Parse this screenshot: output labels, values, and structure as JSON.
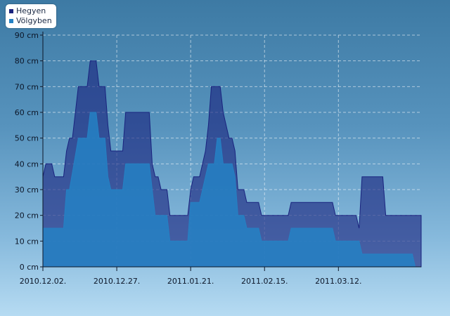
{
  "chart_data": {
    "type": "area",
    "title": "",
    "xlabel": "",
    "ylabel": "",
    "y_unit": "cm",
    "ylim": [
      0,
      90
    ],
    "xlim": [
      "2010-12-02",
      "2011-04-09"
    ],
    "grid": true,
    "legend_position": "top-left",
    "x_tick_labels": [
      "2010.12.02.",
      "2010.12.27.",
      "2011.01.21.",
      "2011.02.15.",
      "2011.03.12."
    ],
    "x_tick_dates": [
      "2010-12-02",
      "2010-12-27",
      "2011-01-21",
      "2011-02-15",
      "2011-03-12"
    ],
    "y_tick_labels": [
      "0 cm",
      "10 cm",
      "20 cm",
      "30 cm",
      "40 cm",
      "50 cm",
      "60 cm",
      "70 cm",
      "80 cm",
      "90 cm"
    ],
    "y_ticks": [
      0,
      10,
      20,
      30,
      40,
      50,
      60,
      70,
      80,
      90
    ],
    "series": [
      {
        "name": "Hegyen",
        "color": "#1a237e",
        "points": [
          [
            "2010-12-02",
            35
          ],
          [
            "2010-12-03",
            40
          ],
          [
            "2010-12-05",
            40
          ],
          [
            "2010-12-06",
            35
          ],
          [
            "2010-12-09",
            35
          ],
          [
            "2010-12-10",
            45
          ],
          [
            "2010-12-11",
            50
          ],
          [
            "2010-12-12",
            50
          ],
          [
            "2010-12-14",
            70
          ],
          [
            "2010-12-17",
            70
          ],
          [
            "2010-12-18",
            80
          ],
          [
            "2010-12-20",
            80
          ],
          [
            "2010-12-21",
            70
          ],
          [
            "2010-12-23",
            70
          ],
          [
            "2010-12-24",
            55
          ],
          [
            "2010-12-25",
            45
          ],
          [
            "2010-12-29",
            45
          ],
          [
            "2010-12-30",
            60
          ],
          [
            "2011-01-07",
            60
          ],
          [
            "2011-01-08",
            40
          ],
          [
            "2011-01-09",
            35
          ],
          [
            "2011-01-10",
            35
          ],
          [
            "2011-01-11",
            30
          ],
          [
            "2011-01-13",
            30
          ],
          [
            "2011-01-14",
            20
          ],
          [
            "2011-01-20",
            20
          ],
          [
            "2011-01-21",
            30
          ],
          [
            "2011-01-22",
            35
          ],
          [
            "2011-01-24",
            35
          ],
          [
            "2011-01-26",
            45
          ],
          [
            "2011-01-27",
            55
          ],
          [
            "2011-01-28",
            70
          ],
          [
            "2011-01-31",
            70
          ],
          [
            "2011-02-01",
            60
          ],
          [
            "2011-02-03",
            50
          ],
          [
            "2011-02-04",
            50
          ],
          [
            "2011-02-05",
            45
          ],
          [
            "2011-02-06",
            30
          ],
          [
            "2011-02-08",
            30
          ],
          [
            "2011-02-09",
            25
          ],
          [
            "2011-02-13",
            25
          ],
          [
            "2011-02-14",
            20
          ],
          [
            "2011-02-23",
            20
          ],
          [
            "2011-02-24",
            25
          ],
          [
            "2011-03-10",
            25
          ],
          [
            "2011-03-11",
            20
          ],
          [
            "2011-03-18",
            20
          ],
          [
            "2011-03-19",
            15
          ],
          [
            "2011-03-20",
            35
          ],
          [
            "2011-03-27",
            35
          ],
          [
            "2011-03-28",
            20
          ],
          [
            "2011-04-09",
            20
          ]
        ]
      },
      {
        "name": "Völgyben",
        "color": "#2581c4",
        "points": [
          [
            "2010-12-02",
            15
          ],
          [
            "2010-12-09",
            15
          ],
          [
            "2010-12-10",
            30
          ],
          [
            "2010-12-11",
            30
          ],
          [
            "2010-12-14",
            50
          ],
          [
            "2010-12-17",
            50
          ],
          [
            "2010-12-18",
            60
          ],
          [
            "2010-12-20",
            60
          ],
          [
            "2010-12-21",
            50
          ],
          [
            "2010-12-23",
            50
          ],
          [
            "2010-12-24",
            35
          ],
          [
            "2010-12-25",
            30
          ],
          [
            "2010-12-29",
            30
          ],
          [
            "2010-12-30",
            40
          ],
          [
            "2011-01-07",
            40
          ],
          [
            "2011-01-08",
            30
          ],
          [
            "2011-01-09",
            20
          ],
          [
            "2011-01-13",
            20
          ],
          [
            "2011-01-14",
            10
          ],
          [
            "2011-01-20",
            10
          ],
          [
            "2011-01-21",
            25
          ],
          [
            "2011-01-24",
            25
          ],
          [
            "2011-01-26",
            35
          ],
          [
            "2011-01-27",
            40
          ],
          [
            "2011-01-29",
            40
          ],
          [
            "2011-01-30",
            50
          ],
          [
            "2011-01-31",
            50
          ],
          [
            "2011-02-01",
            40
          ],
          [
            "2011-02-04",
            40
          ],
          [
            "2011-02-05",
            35
          ],
          [
            "2011-02-06",
            20
          ],
          [
            "2011-02-08",
            20
          ],
          [
            "2011-02-09",
            15
          ],
          [
            "2011-02-13",
            15
          ],
          [
            "2011-02-14",
            10
          ],
          [
            "2011-02-23",
            10
          ],
          [
            "2011-02-24",
            15
          ],
          [
            "2011-03-10",
            15
          ],
          [
            "2011-03-11",
            10
          ],
          [
            "2011-03-19",
            10
          ],
          [
            "2011-03-20",
            5
          ],
          [
            "2011-04-06",
            5
          ],
          [
            "2011-04-07",
            0
          ],
          [
            "2011-04-09",
            0
          ]
        ]
      }
    ]
  }
}
